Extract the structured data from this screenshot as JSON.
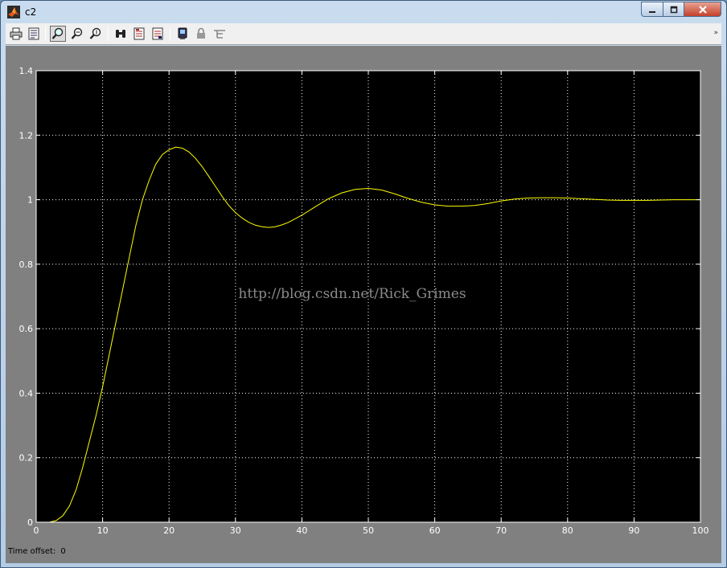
{
  "window": {
    "title": "c2",
    "min_icon": "minimize-icon",
    "max_icon": "maximize-icon",
    "close_icon": "close-icon"
  },
  "toolbar": {
    "items": [
      {
        "name": "print-icon"
      },
      {
        "name": "print-preview-icon"
      },
      {
        "name": "zoom-icon"
      },
      {
        "name": "zoom-x-icon"
      },
      {
        "name": "zoom-y-icon"
      },
      {
        "name": "autoscale-binoculars-icon"
      },
      {
        "name": "save-axes-settings-icon"
      },
      {
        "name": "restore-axes-settings-icon"
      },
      {
        "name": "floating-scope-icon"
      },
      {
        "name": "lock-axes-icon"
      },
      {
        "name": "signal-selection-icon"
      }
    ]
  },
  "footer": {
    "label": "Time offset:",
    "value": "0"
  },
  "watermark": "http://blog.csdn.net/Rick_Grimes",
  "chart_data": {
    "type": "line",
    "xlim": [
      0,
      100
    ],
    "ylim": [
      0,
      1.4
    ],
    "xticks": [
      0,
      10,
      20,
      30,
      40,
      50,
      60,
      70,
      80,
      90,
      100
    ],
    "yticks": [
      0,
      0.2,
      0.4,
      0.6,
      0.8,
      1,
      1.2,
      1.4
    ],
    "xtick_labels": [
      "0",
      "10",
      "20",
      "30",
      "40",
      "50",
      "60",
      "70",
      "80",
      "90",
      "100"
    ],
    "ytick_labels": [
      "0",
      "0.2",
      "0.4",
      "0.6",
      "0.8",
      "1",
      "1.2",
      "1.4"
    ],
    "grid": true,
    "background": "#000000",
    "grid_color": "#ffffff",
    "line_color": "#ffff00",
    "series": [
      {
        "x": [
          0,
          2,
          3,
          4,
          5,
          6,
          7,
          8,
          9,
          10,
          11,
          12,
          13,
          14,
          15,
          16,
          17,
          18,
          19,
          20,
          21,
          22,
          23,
          24,
          25,
          26,
          27,
          28,
          29,
          30,
          31,
          32,
          33,
          34,
          35,
          36,
          37,
          38,
          40,
          42,
          44,
          46,
          48,
          50,
          52,
          54,
          56,
          58,
          60,
          62,
          64,
          66,
          68,
          70,
          72,
          74,
          76,
          78,
          80,
          82,
          84,
          86,
          88,
          90,
          92,
          94,
          96,
          98,
          100
        ],
        "values": [
          0,
          0,
          0.005,
          0.02,
          0.05,
          0.1,
          0.17,
          0.25,
          0.33,
          0.42,
          0.52,
          0.62,
          0.72,
          0.82,
          0.92,
          1.0,
          1.06,
          1.11,
          1.14,
          1.155,
          1.163,
          1.16,
          1.148,
          1.128,
          1.102,
          1.072,
          1.041,
          1.01,
          0.982,
          0.96,
          0.943,
          0.93,
          0.921,
          0.916,
          0.914,
          0.916,
          0.922,
          0.93,
          0.952,
          0.978,
          1.003,
          1.021,
          1.032,
          1.035,
          1.03,
          1.018,
          1.004,
          0.992,
          0.984,
          0.98,
          0.98,
          0.982,
          0.988,
          0.996,
          1.002,
          1.005,
          1.006,
          1.006,
          1.005,
          1.003,
          1.001,
          0.999,
          0.998,
          0.998,
          0.998,
          0.999,
          1.0,
          1.0,
          1.0
        ]
      }
    ]
  }
}
